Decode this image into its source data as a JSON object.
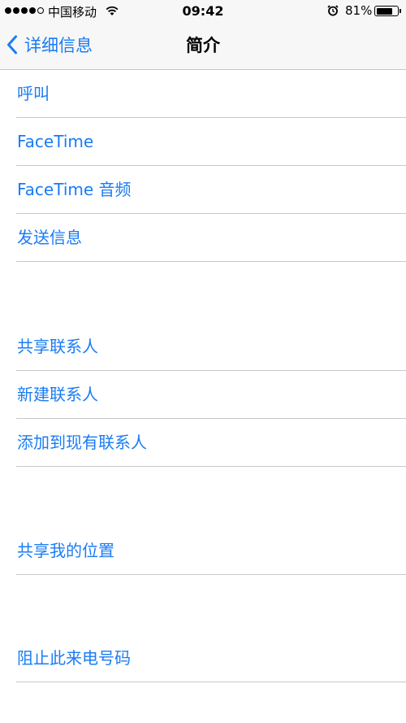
{
  "status_bar": {
    "carrier": "中国移动",
    "time": "09:42",
    "battery_text": "81%",
    "battery_level": 0.81,
    "signal_bars_filled": 4,
    "signal_bars_total": 5
  },
  "nav": {
    "back_label": "详细信息",
    "title": "简介"
  },
  "sections": [
    {
      "items": [
        {
          "label": "呼叫"
        },
        {
          "label": "FaceTime"
        },
        {
          "label": "FaceTime 音频"
        },
        {
          "label": "发送信息"
        }
      ]
    },
    {
      "items": [
        {
          "label": "共享联系人"
        },
        {
          "label": "新建联系人"
        },
        {
          "label": "添加到现有联系人"
        }
      ]
    },
    {
      "items": [
        {
          "label": "共享我的位置"
        }
      ]
    },
    {
      "items": [
        {
          "label": "阻止此来电号码"
        }
      ]
    }
  ],
  "colors": {
    "accent": "#1a7cf5",
    "separator": "#c8c7cc",
    "bar_background": "#f7f7f7"
  }
}
